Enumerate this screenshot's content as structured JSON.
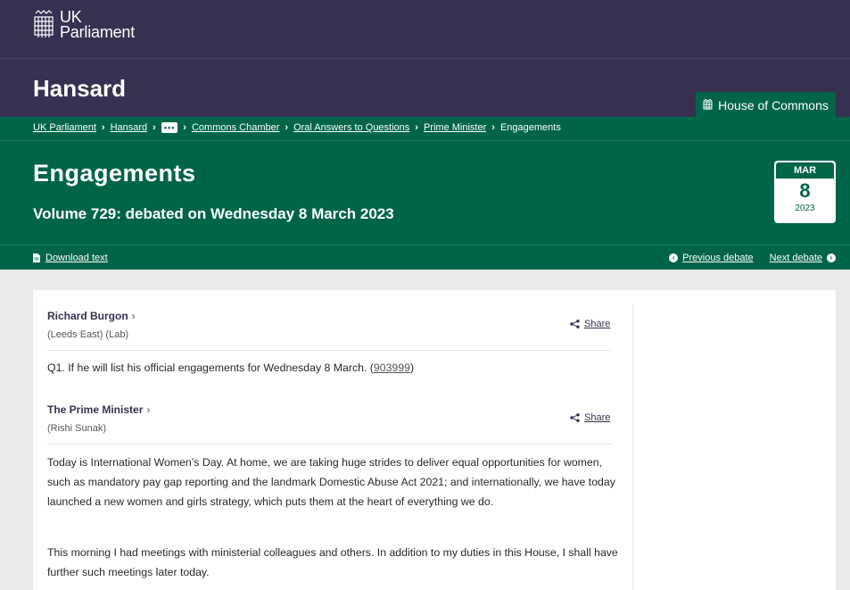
{
  "brand": {
    "line1": "UK",
    "line2": "Parliament",
    "logo_icon": "portcullis-icon"
  },
  "hansard": {
    "title": "Hansard",
    "house_tab": "House of Commons"
  },
  "breadcrumb": {
    "items": [
      "UK Parliament",
      "Hansard",
      "Commons Chamber",
      "Oral Answers to Questions",
      "Prime Minister"
    ],
    "more": "•••",
    "current": "Engagements"
  },
  "page": {
    "title": "Engagements",
    "subtitle": "Volume 729: debated on Wednesday 8 March 2023",
    "date": {
      "month": "MAR",
      "day": "8",
      "year": "2023"
    }
  },
  "actions": {
    "download": "Download text",
    "previous": "Previous debate",
    "next": "Next debate"
  },
  "contributions": [
    {
      "name": "Richard Burgon",
      "constituency": "(Leeds East) (Lab)",
      "share": "Share",
      "text": "Q1. If he will list his official engagements for Wednesday 8 March.",
      "ref": "903999"
    },
    {
      "name": "The Prime Minister",
      "constituency": "(Rishi Sunak)",
      "share": "Share",
      "paragraphs": [
        "Today is International Women’s Day. At home, we are taking huge strides to deliver equal opportunities for women, such as mandatory pay gap reporting and the landmark Domestic Abuse Act 2021; and internationally, we have today launched a new women and girls strategy, which puts them at the heart of everything we do.",
        "This morning I had meetings with ministerial colleagues and others. In addition to my duties in this House, I shall have further such meetings later today."
      ]
    }
  ],
  "colors": {
    "purple": "#373151",
    "green": "#006548",
    "grey_bg": "#ebe9e8"
  }
}
